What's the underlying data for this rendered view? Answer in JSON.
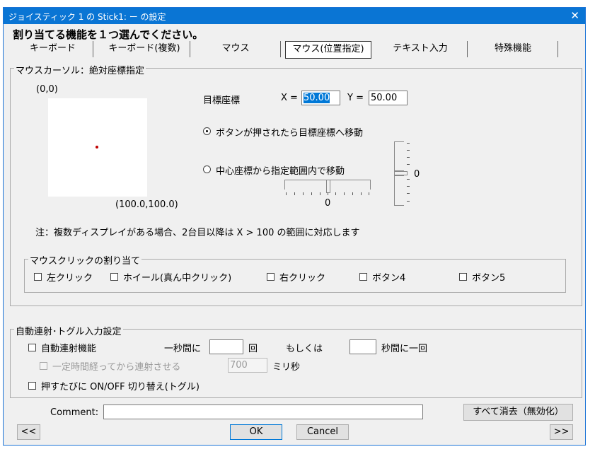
{
  "window": {
    "title": "ジョイスティック 1 の Stick1: ー の設定",
    "close_glyph": "✕"
  },
  "heading": "割り当てる機能を１つ選んでください。",
  "tabs": [
    {
      "label": "キーボード"
    },
    {
      "label": "キーボード(複数)"
    },
    {
      "label": "マウス"
    },
    {
      "label": "マウス(位置指定)",
      "selected": true
    },
    {
      "label": "テキスト入力"
    },
    {
      "label": "特殊機能"
    }
  ],
  "absolute": {
    "group_label": "マウスカーソル：絶対座標指定",
    "origin_label": "(0,0)",
    "max_label": "(100.0,100.0)",
    "target": {
      "label": "目標座標",
      "x_label": "X =",
      "x_value": "50.00",
      "y_label": "Y =",
      "y_value": "50.00"
    },
    "radio_move_target": "ボタンが押されたら目標座標へ移動",
    "radio_move_range": "中心座標から指定範囲内で移動",
    "h_slider_value": "0",
    "v_slider_value": "0",
    "note": "注：複数ディスプレイがある場合、2台目以降は X > 100 の範囲に対応します",
    "click": {
      "group_label": "マウスクリックの割り当て",
      "left": "左クリック",
      "wheel": "ホイール(真ん中クリック)",
      "right": "右クリック",
      "button4": "ボタン4",
      "button5": "ボタン5"
    }
  },
  "auto": {
    "group_label": "自動連射･トグル入力設定",
    "rapid_label": "自動連射機能",
    "per_sec_label": "一秒間に",
    "times_label": "回",
    "or_label": "もしくは",
    "per_n_sec_label": "秒間に一回",
    "delay_label": "一定時間経ってから連射させる",
    "delay_value": "700",
    "ms_label": "ミリ秒",
    "toggle_label": "押すたびに ON/OFF 切り替え(トグル)"
  },
  "footer": {
    "comment_label": "Comment:",
    "comment_value": "",
    "clear_all": "すべて消去（無効化）",
    "prev": "<<",
    "ok": "OK",
    "cancel": "Cancel",
    "next": ">>"
  },
  "colors": {
    "titlebar": "#0a75d4",
    "accent": "#1a73d6",
    "dialog_bg": "#f0f0f0",
    "cursor_dot": "#c00000"
  }
}
